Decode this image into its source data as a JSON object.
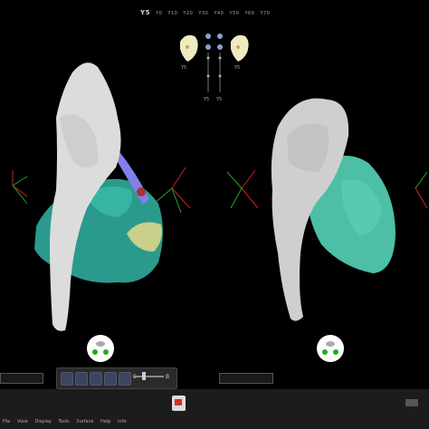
{
  "series_selector": {
    "active": "Y5",
    "items": [
      "Y0",
      "Y10",
      "Y20",
      "Y30",
      "Y40",
      "Y50",
      "Y60",
      "Y70"
    ]
  },
  "mini_thumbs": {
    "left_label": "Y5",
    "right_label": "Y5",
    "center_left_label": "Y5",
    "center_right_label": "Y5"
  },
  "menu": {
    "items": [
      "File",
      "View",
      "Display",
      "Tools",
      "Surface",
      "Help",
      "Info"
    ]
  },
  "toolbar": {
    "left_marker": "S",
    "right_marker": "B"
  },
  "colors": {
    "background": "#000000",
    "bone": "#d9d9d9",
    "tissue": "#2fa89a",
    "vessel": "#8080e8",
    "skull_thumb": "#f0eac0"
  },
  "icons": {
    "left_orientation": "head-orientation-icon",
    "right_orientation": "head-orientation-icon",
    "dock": "app-dock-icon",
    "corner": "device-icon"
  }
}
